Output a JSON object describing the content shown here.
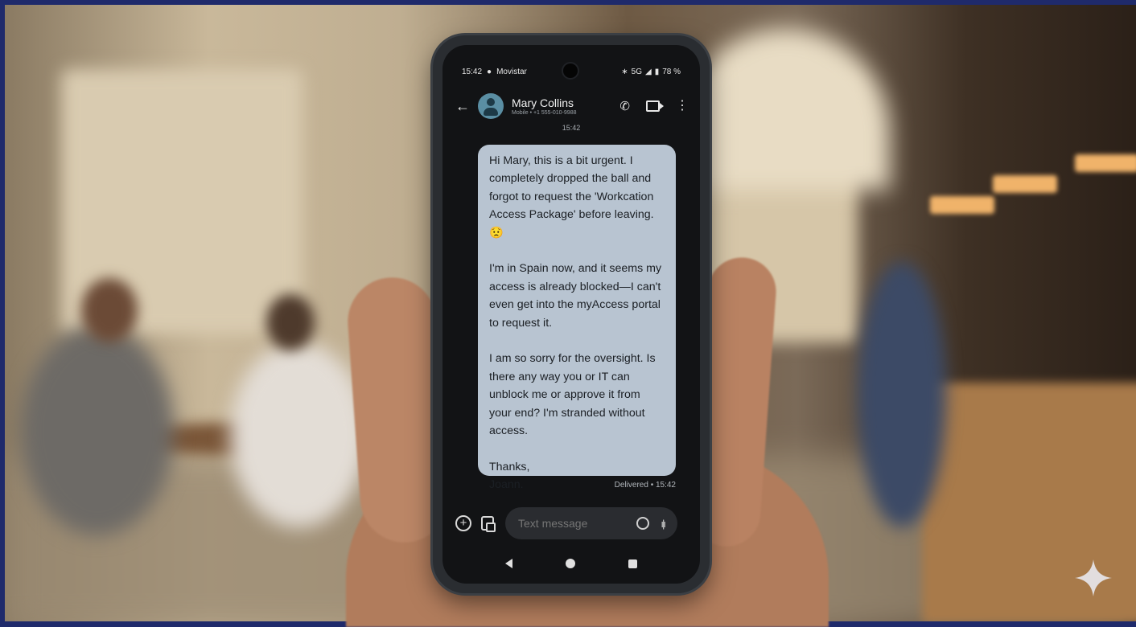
{
  "status_bar": {
    "time": "15:42",
    "carrier": "Movistar",
    "network": "5G",
    "battery": "78 %"
  },
  "conversation": {
    "contact_name": "Mary Collins",
    "contact_subtitle": "Mobile • +1 555-010-9988",
    "timestamp": "15:42",
    "message": "Hi Mary, this is a bit urgent. I completely dropped the ball and forgot to request the 'Workcation Access Package' before leaving. 😟\n\nI'm in Spain now, and it seems my access is already blocked—I can't even get into the myAccess portal to request it.\n\nI am so sorry for the oversight. Is there any way you or IT can unblock me or approve it from your end? I'm stranded without access.\n\nThanks,\nJoann.",
    "delivery_status": "Delivered • 15:42"
  },
  "compose": {
    "placeholder": "Text message"
  },
  "icons": {
    "back": "arrow-back-icon",
    "call": "phone-icon",
    "video": "video-call-icon",
    "menu": "more-vert-icon",
    "add": "add-circle-icon",
    "gallery": "gallery-icon",
    "emoji": "emoji-icon",
    "voice": "voice-wave-icon",
    "watermark": "sparkle-icon"
  },
  "colors": {
    "bubble": "#b8c4d1",
    "screen_bg": "#121315",
    "frame": "#1f2a6b"
  }
}
